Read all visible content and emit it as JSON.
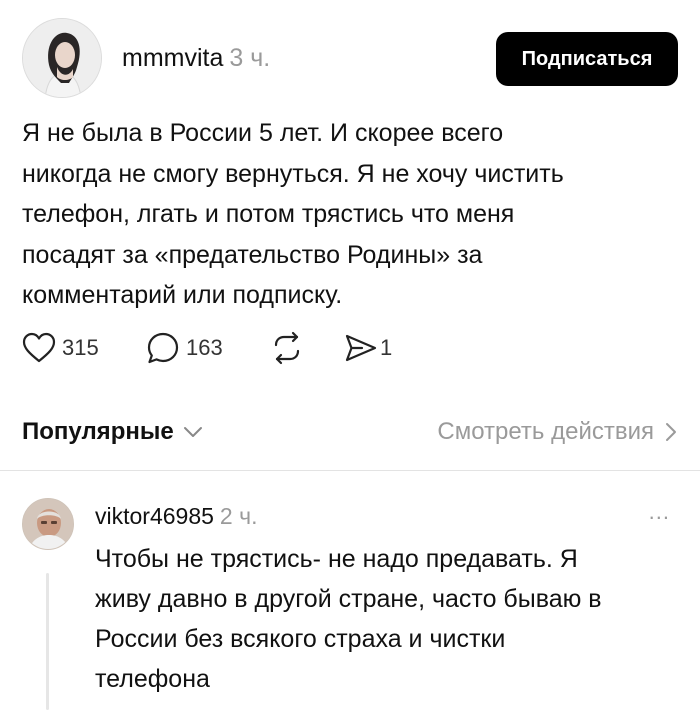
{
  "post": {
    "author": "mmmvita",
    "time": "3 ч.",
    "subscribe_label": "Подписаться",
    "text": "Я не была в России 5 лет. И скорее всего\nникогда не смогу вернуться. Я не хочу чистить\nтелефон, лгать и потом трястись что меня\nпосадят за «предательство Родины» за\nкомментарий или подписку.",
    "actions": {
      "likes": "315",
      "comments": "163",
      "shares": "1",
      "icons": [
        "heart-icon",
        "comment-icon",
        "repost-icon",
        "send-icon"
      ]
    }
  },
  "sort": {
    "label": "Популярные",
    "view_activity_label": "Смотреть действия"
  },
  "comment": {
    "author": "viktor46985",
    "time": "2 ч.",
    "more_label": "...",
    "text": "Чтобы не трястись- не надо предавать. Я\nживу давно в другой стране,  часто бываю в\nРоссии без всякого страха и чистки\nтелефона"
  },
  "colors": {
    "text": "#111111",
    "muted": "#9a9a9a",
    "button_bg": "#000000",
    "button_text": "#ffffff",
    "divider": "#e3e3e3"
  }
}
